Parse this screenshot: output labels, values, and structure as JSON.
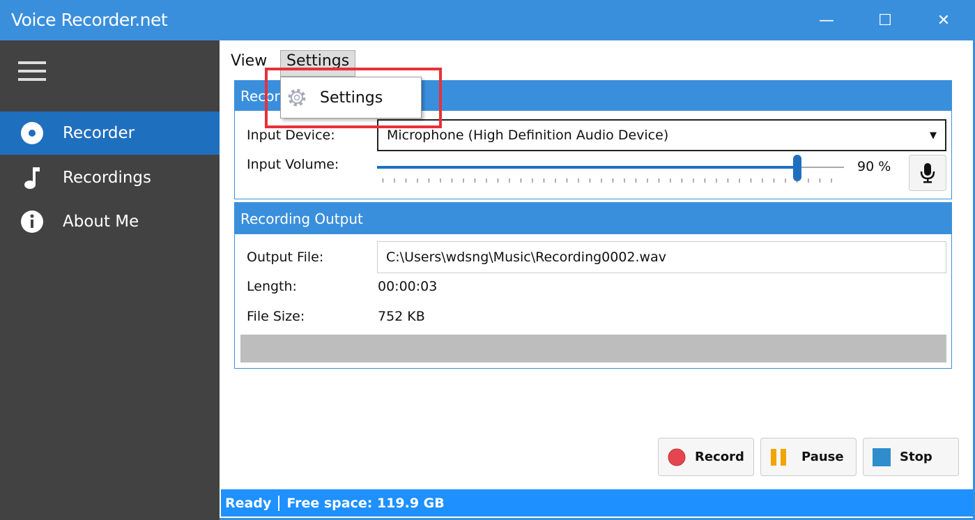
{
  "window": {
    "title": "Voice Recorder.net",
    "minimize": "—",
    "maximize": "☐",
    "close": "✕"
  },
  "sidebar": {
    "items": [
      {
        "label": "Recorder",
        "icon": "disc-icon",
        "selected": true
      },
      {
        "label": "Recordings",
        "icon": "music-note-icon"
      },
      {
        "label": "About Me",
        "icon": "info-icon"
      }
    ]
  },
  "menu": {
    "view": "View",
    "settings": "Settings",
    "dropdown_item": "Settings"
  },
  "recording_group": {
    "title": "Recording",
    "input_device_label": "Input Device:",
    "input_device_value": "Microphone (High Definition Audio Device)",
    "input_volume_label": "Input Volume:",
    "volume_percent": 90,
    "volume_text": "90 %"
  },
  "output_group": {
    "title": "Recording Output",
    "output_file_label": "Output File:",
    "output_file_value": "C:\\Users\\wdsng\\Music\\Recording0002.wav",
    "length_label": "Length:",
    "length_value": "00:00:03",
    "file_size_label": "File Size:",
    "file_size_value": "752 KB"
  },
  "buttons": {
    "record": "Record",
    "pause": "Pause",
    "stop": "Stop"
  },
  "status": {
    "state": "Ready",
    "free_space": "Free space: 119.9 GB"
  },
  "colors": {
    "accent": "#3a8fdc",
    "sidebar": "#424242",
    "selected": "#1f6fbf",
    "status": "#1e90ff",
    "highlight": "#e8303a"
  }
}
